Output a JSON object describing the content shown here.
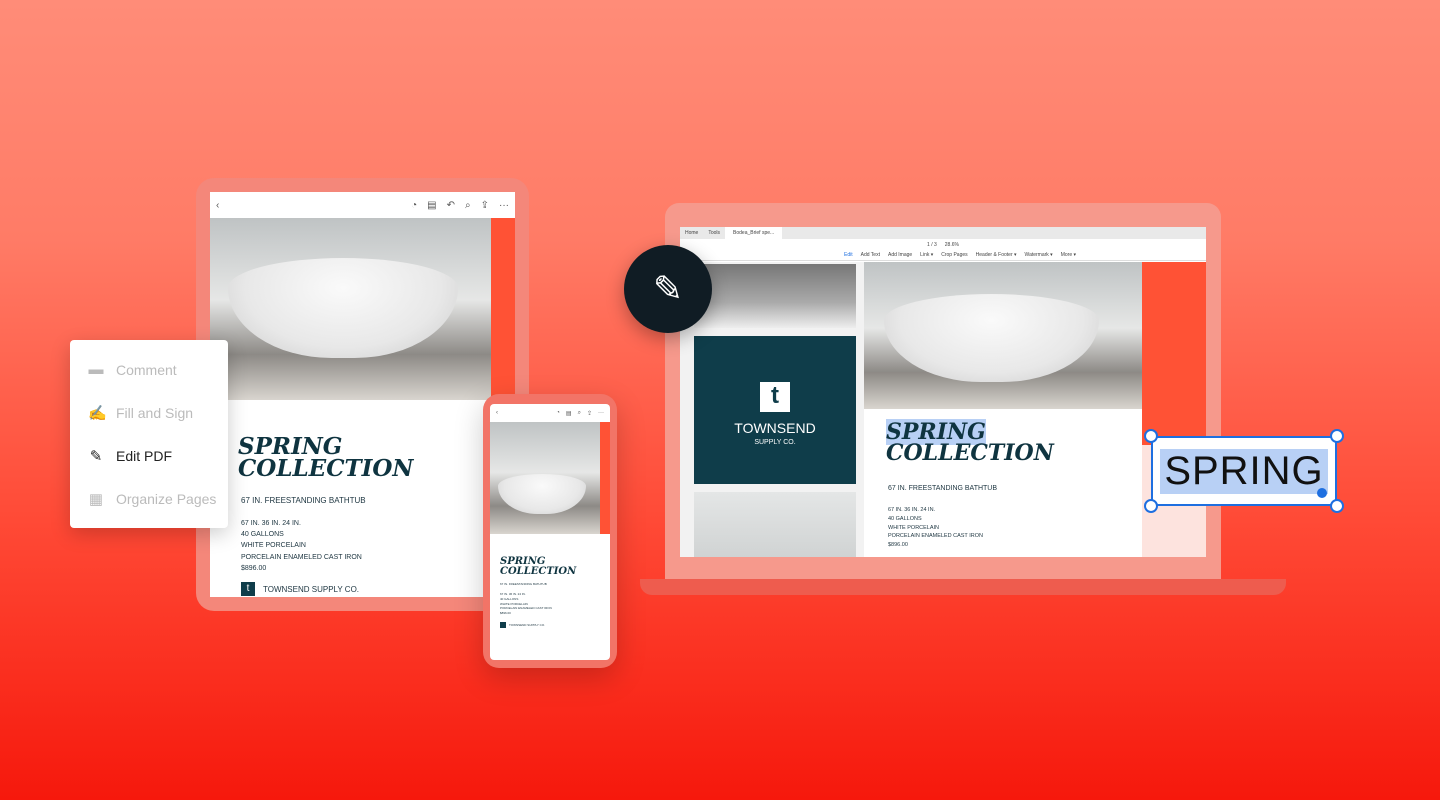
{
  "menu": {
    "items": [
      {
        "label": "Comment",
        "icon": "comment-icon",
        "active": false
      },
      {
        "label": "Fill and Sign",
        "icon": "pen-sign-icon",
        "active": false
      },
      {
        "label": "Edit PDF",
        "icon": "pencil-icon",
        "active": true
      },
      {
        "label": "Organize Pages",
        "icon": "pages-icon",
        "active": false
      }
    ]
  },
  "doc": {
    "title1": "SPRING",
    "title2": "COLLECTION",
    "product": "67 IN. FREESTANDING BATHTUB",
    "specs": [
      "67 IN. 36 IN. 24 IN.",
      "40 GALLONS",
      "WHITE PORCELAIN",
      "PORCELAIN ENAMELED CAST IRON",
      "$896.00"
    ],
    "brand": "TOWNSEND SUPPLY CO.",
    "brand_line1": "TOWNSEND",
    "brand_line2": "SUPPLY CO.",
    "logo_letter": "t"
  },
  "laptop": {
    "tabs": [
      "Home",
      "Tools",
      "Bodea_Brief spe..."
    ],
    "page": "1 / 3",
    "zoom": "28.6%",
    "edit_tools": [
      "Edit",
      "Add Text",
      "Add Image",
      "Link ▾",
      "Crop Pages",
      "Header & Footer ▾",
      "Watermark ▾",
      "More ▾"
    ]
  },
  "edit_box": {
    "text": "SPRING"
  },
  "colors": {
    "accent": "#ff5235",
    "selection": "#1e6fe0",
    "brand": "#0f3d4a"
  }
}
